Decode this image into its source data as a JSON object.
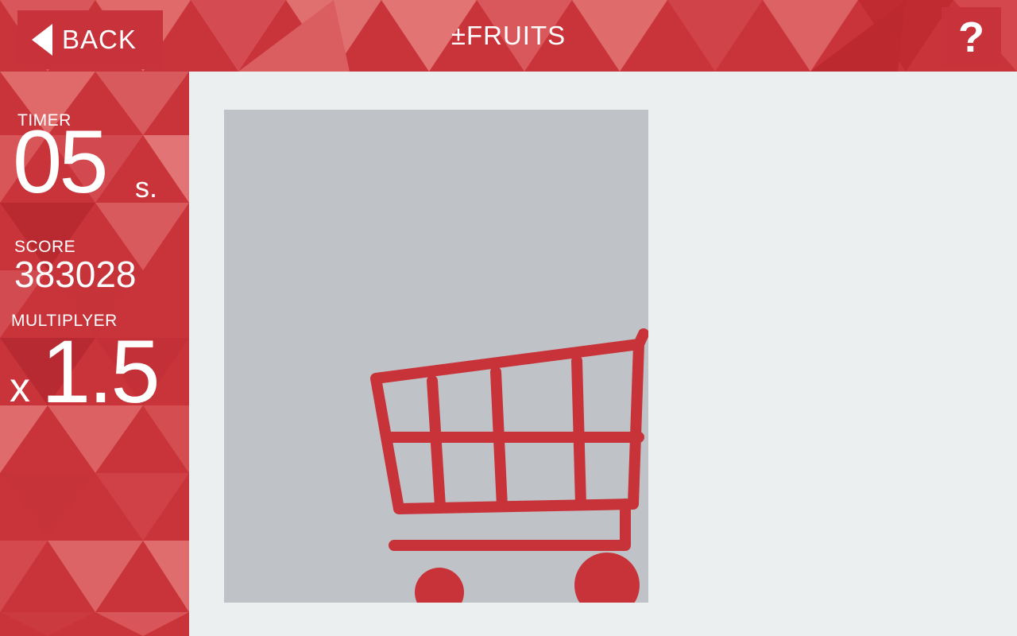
{
  "header": {
    "back_label": "BACK",
    "title": "±FRUITS",
    "help_label": "?"
  },
  "stats": {
    "timer_label": "TIMER",
    "timer_value": "05",
    "timer_unit": "s.",
    "score_label": "SCORE",
    "score_value": "383028",
    "multiplier_label": "MULTIPLYER",
    "multiplier_prefix": "x",
    "multiplier_value": "1.5"
  },
  "icons": {
    "back": "back-arrow-icon",
    "cart": "shopping-cart-icon"
  },
  "colors": {
    "primary_red": "#c8323a",
    "panel_gray": "#bfc3c7",
    "game_bg": "#ebeff0",
    "cart_red": "#c8333a"
  }
}
